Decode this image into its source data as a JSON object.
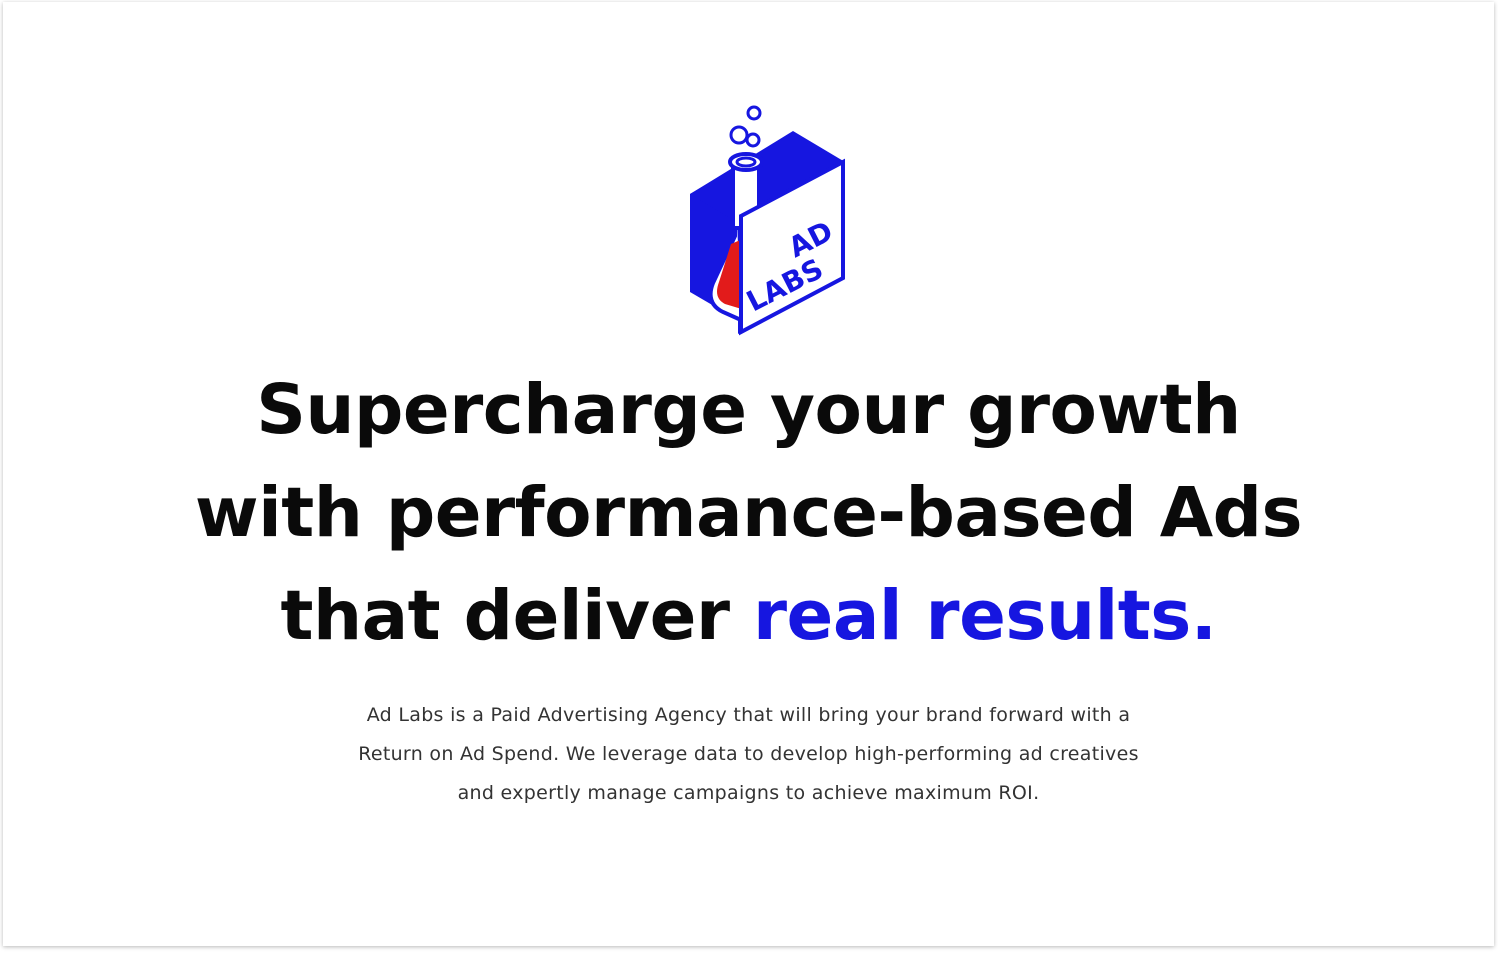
{
  "logo": {
    "text_line1": "AD",
    "text_line2": "LABS",
    "colors": {
      "primary": "#1616e0",
      "liquid": "#e21b1b",
      "panel": "#ffffff"
    },
    "icon": "flask-box-logo"
  },
  "hero": {
    "headline_line1": "Supercharge your growth",
    "headline_line2": "with performance-based Ads",
    "headline_line3_prefix": "that deliver ",
    "headline_line3_accent": "real results.",
    "accent_color": "#1616e0",
    "description_line1": "Ad Labs is a Paid Advertising Agency that will bring your brand forward with a",
    "description_line2": "Return on Ad Spend. We leverage data to develop high-performing ad creatives",
    "description_line3": "and expertly manage campaigns to achieve maximum ROI."
  }
}
